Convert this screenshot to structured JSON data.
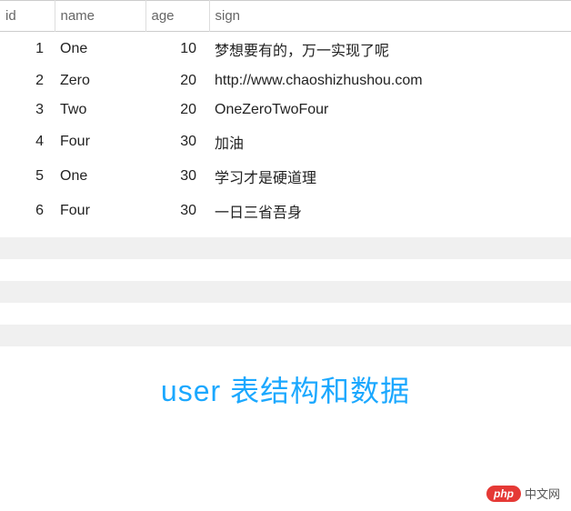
{
  "table": {
    "headers": {
      "id": "id",
      "name": "name",
      "age": "age",
      "sign": "sign"
    },
    "rows": [
      {
        "id": "1",
        "name": "One",
        "age": "10",
        "sign": "梦想要有的，万一实现了呢"
      },
      {
        "id": "2",
        "name": "Zero",
        "age": "20",
        "sign": "http://www.chaoshizhushou.com"
      },
      {
        "id": "3",
        "name": "Two",
        "age": "20",
        "sign": "OneZeroTwoFour"
      },
      {
        "id": "4",
        "name": "Four",
        "age": "30",
        "sign": "加油"
      },
      {
        "id": "5",
        "name": "One",
        "age": "30",
        "sign": "学习才是硬道理"
      },
      {
        "id": "6",
        "name": "Four",
        "age": "30",
        "sign": "一日三省吾身"
      }
    ]
  },
  "caption": "user 表结构和数据",
  "footer": {
    "badge": "php",
    "text": "中文网"
  }
}
